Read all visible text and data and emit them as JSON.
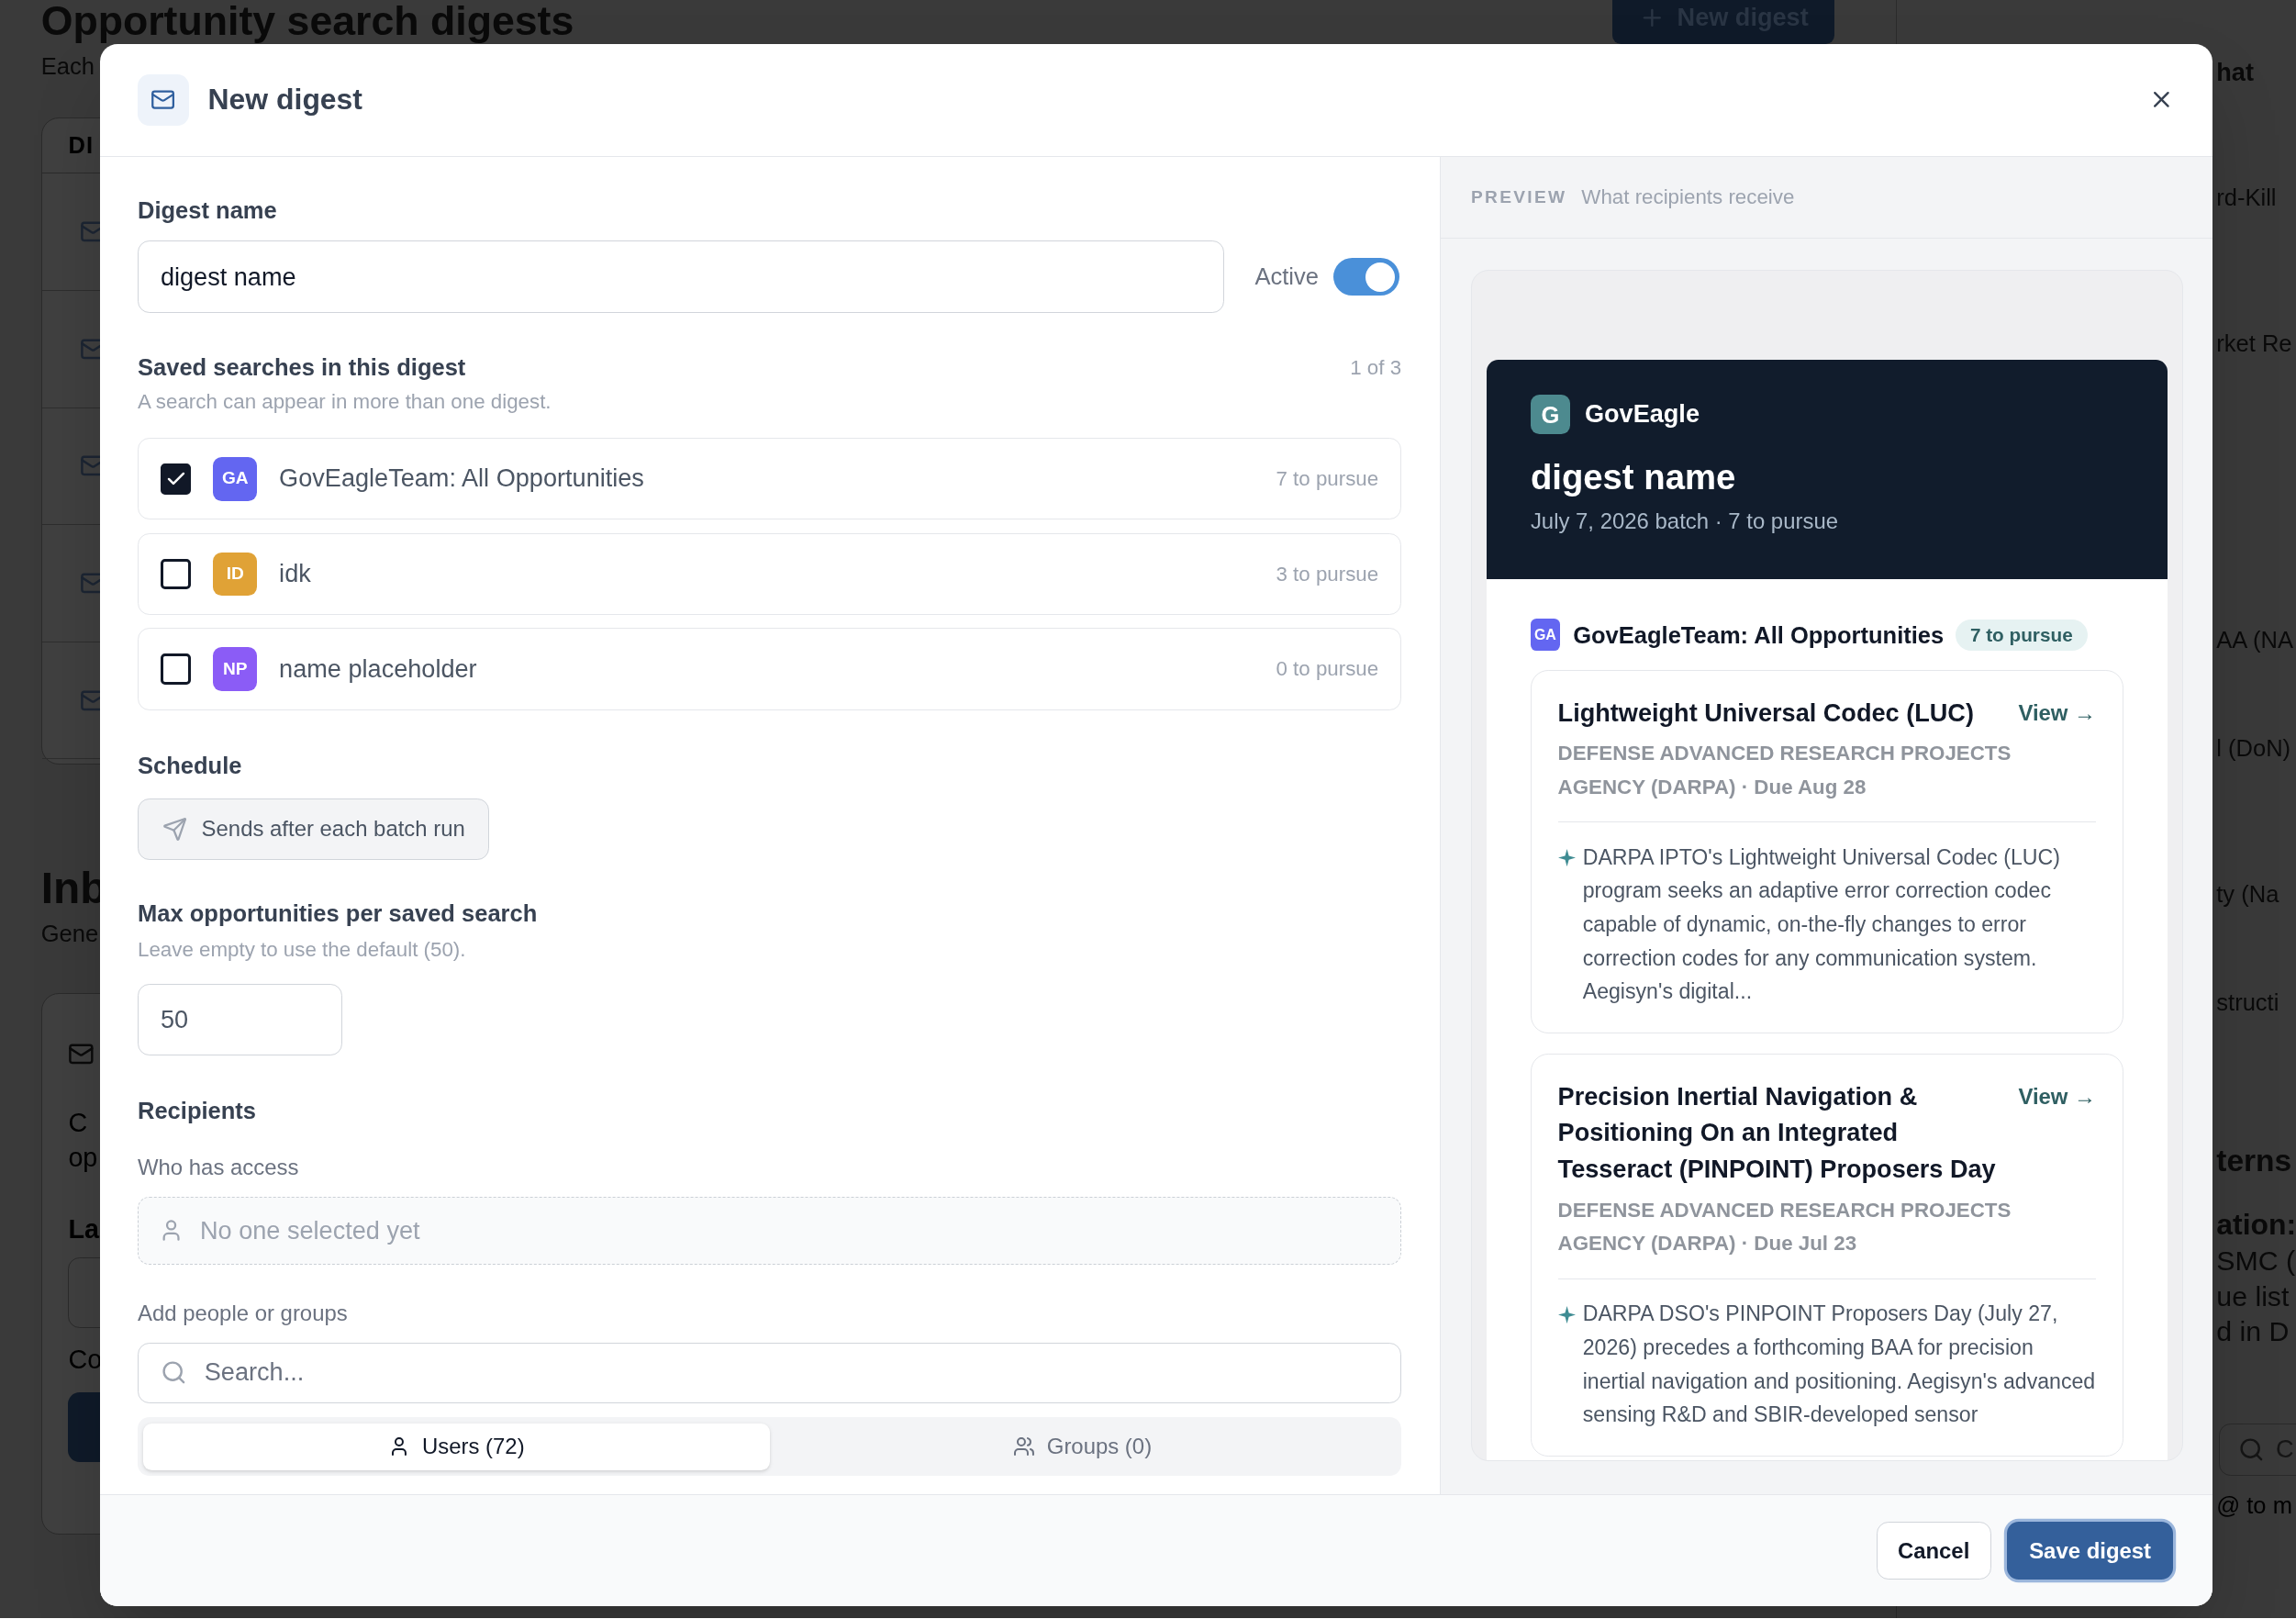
{
  "background": {
    "title": "Opportunity search digests",
    "subtitle": "Each",
    "new_button": "New digest",
    "table_header": "DI",
    "inbox": {
      "title": "Inb",
      "subtitle": "Gene",
      "line_1": "C",
      "line_2": "op",
      "label": "La",
      "note": "Co"
    },
    "right": [
      {
        "kind": "heading",
        "text": "hat"
      },
      {
        "kind": "row",
        "text": "rd-Kill"
      },
      {
        "kind": "row",
        "text": "rket Re"
      },
      {
        "kind": "row",
        "text": "AA (NA"
      },
      {
        "kind": "row",
        "text": "l (DoN)"
      },
      {
        "kind": "row",
        "text": "ty (Na"
      },
      {
        "kind": "row",
        "text": "structi"
      },
      {
        "kind": "title",
        "text": "terns"
      },
      {
        "kind": "bold",
        "text": "ation:"
      },
      {
        "kind": "line",
        "text": "SMC ("
      },
      {
        "kind": "line",
        "text": "ue list"
      },
      {
        "kind": "line",
        "text": "d in D"
      },
      {
        "kind": "search",
        "text": "C"
      },
      {
        "kind": "hint",
        "text": "@ to m"
      }
    ]
  },
  "dialog": {
    "title": "New digest",
    "name_label": "Digest name",
    "name_value": "digest name",
    "active_label": "Active",
    "active_on": true,
    "searches_label": "Saved searches in this digest",
    "searches_count": "1 of 3",
    "searches_hint": "A search can appear in more than one digest.",
    "searches": [
      {
        "initials": "GA",
        "color": "#6366f1",
        "name": "GovEagleTeam: All Opportunities",
        "count": "7 to pursue",
        "checked": true
      },
      {
        "initials": "ID",
        "color": "#e0a236",
        "name": "idk",
        "count": "3 to pursue",
        "checked": false
      },
      {
        "initials": "NP",
        "color": "#8b5cf6",
        "name": "name placeholder",
        "count": "0 to pursue",
        "checked": false
      }
    ],
    "schedule_label": "Schedule",
    "schedule_button": "Sends after each batch run",
    "max_label": "Max opportunities per saved search",
    "max_hint": "Leave empty to use the default (50).",
    "max_value": "50",
    "recipients_label": "Recipients",
    "access_label": "Who has access",
    "access_empty": "No one selected yet",
    "add_label": "Add people or groups",
    "search_placeholder": "Search...",
    "tabs": [
      {
        "label": "Users (72)",
        "kind": "users",
        "selected": true
      },
      {
        "label": "Groups (0)",
        "kind": "groups",
        "selected": false
      }
    ],
    "preview": {
      "tag": "PREVIEW",
      "caption": "What recipients receive",
      "brand_initial": "G",
      "brand": "GovEagle",
      "digest_title": "digest name",
      "batch": "July 7, 2026 batch · 7 to pursue",
      "search": {
        "initials": "GA",
        "color": "#6366f1",
        "name": "GovEagleTeam: All Opportunities",
        "badge": "7 to pursue"
      },
      "items": [
        {
          "title": "Lightweight Universal Codec (LUC)",
          "link": "View →",
          "agency": "DEFENSE ADVANCED RESEARCH PROJECTS AGENCY (DARPA) · Due Aug 28",
          "summary": "DARPA IPTO's Lightweight Universal Codec (LUC) program seeks an adaptive error correction codec capable of dynamic, on-the-fly changes to error correction codes for any communication system. Aegisyn's digital..."
        },
        {
          "title": "Precision Inertial Navigation & Positioning On an Integrated Tesseract (PINPOINT) Proposers Day",
          "link": "View →",
          "agency": "DEFENSE ADVANCED RESEARCH PROJECTS AGENCY (DARPA) · Due Jul 23",
          "summary": "DARPA DSO's PINPOINT Proposers Day (July 27, 2026) precedes a forthcoming BAA for precision inertial navigation and positioning. Aegisyn's advanced sensing R&D and SBIR-developed sensor"
        }
      ]
    },
    "cancel": "Cancel",
    "save": "Save digest"
  }
}
